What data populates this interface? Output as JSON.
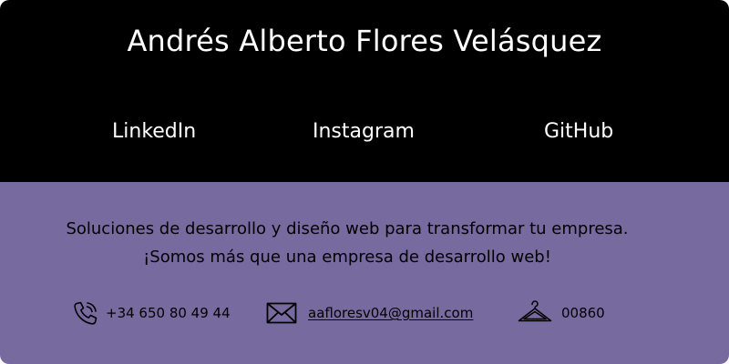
{
  "header": {
    "name": "Andrés Alberto Flores Velásquez",
    "social": {
      "linkedin": "LinkedIn",
      "instagram": "Instagram",
      "github": "GitHub"
    }
  },
  "footer": {
    "tagline_line1": "Soluciones de desarrollo y diseño web para transformar tu empresa.",
    "tagline_line2": "¡Somos más que una empresa de desarrollo web!",
    "contact": {
      "phone": "+34 650 80 49 44",
      "email": "aafloresv04@gmail.com",
      "postal_code": "00860"
    }
  },
  "colors": {
    "header_bg": "#000000",
    "footer_bg": "#766a9f",
    "header_text": "#ffffff",
    "footer_text": "#000000"
  },
  "icons": {
    "phone": "phone-icon",
    "email": "envelope-icon",
    "postal": "hanger-icon"
  }
}
